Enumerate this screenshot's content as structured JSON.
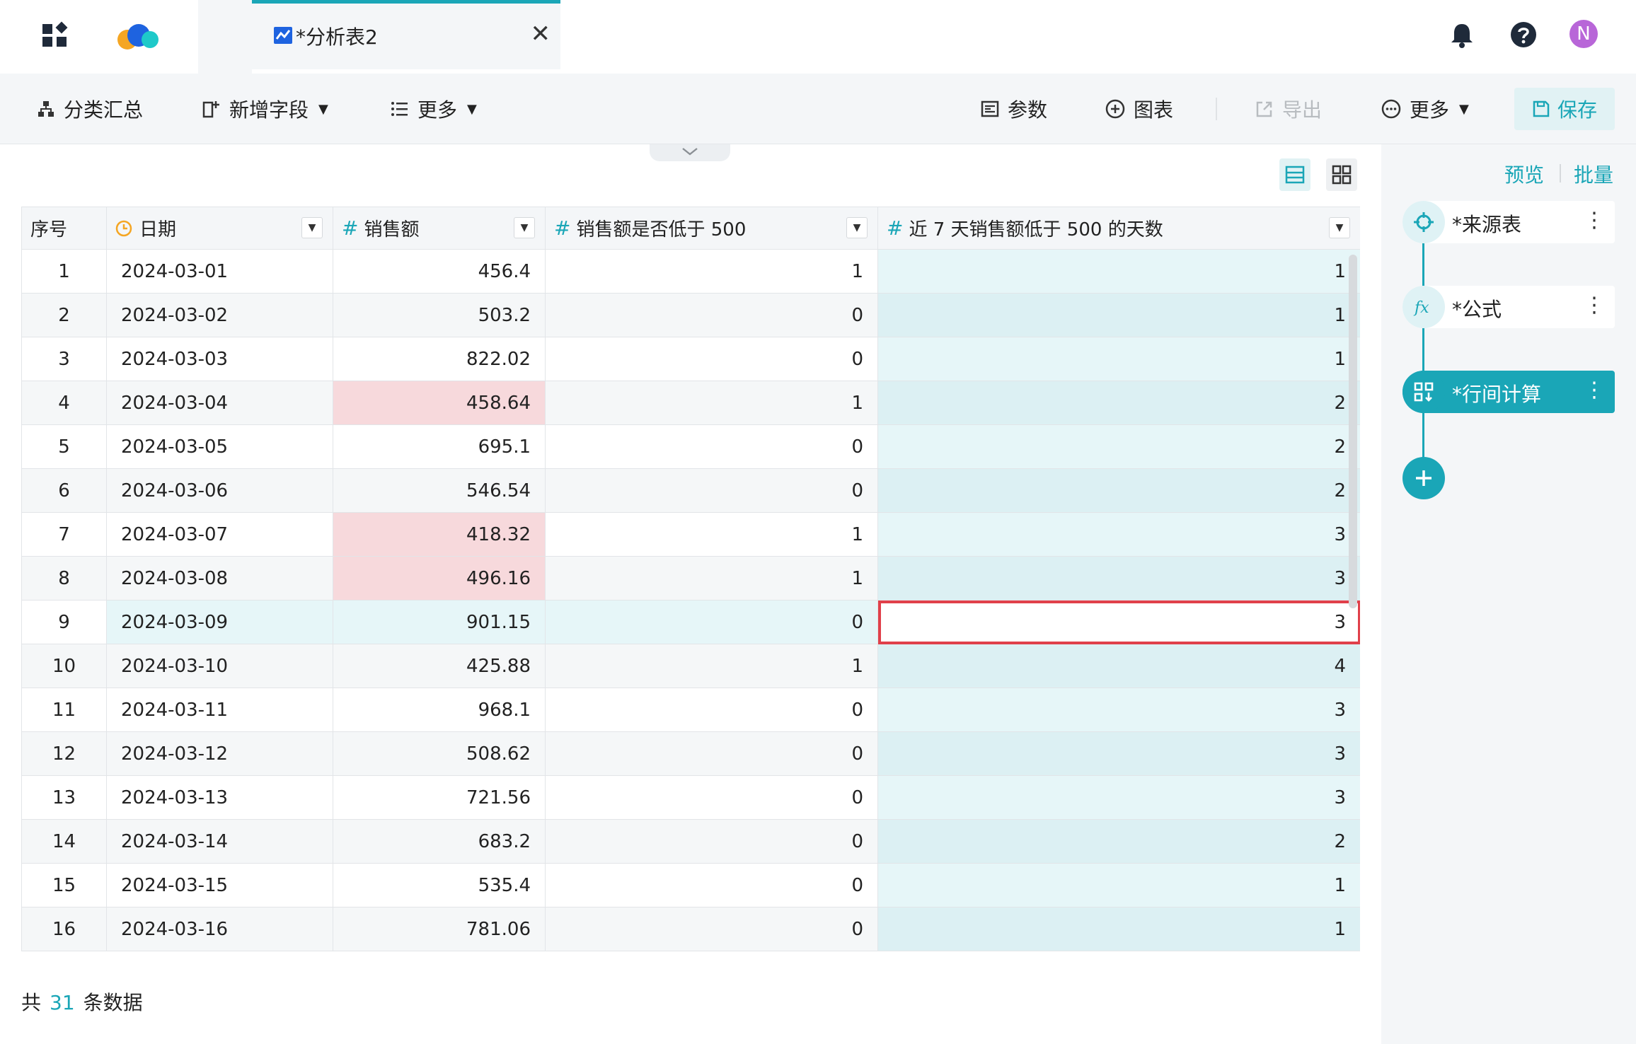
{
  "tab": {
    "title": "*分析表2",
    "close": "✕"
  },
  "user": {
    "avatar_letter": "N"
  },
  "toolbar": {
    "group_summary": "分类汇总",
    "add_field": "新增字段",
    "more_left": "更多",
    "params": "参数",
    "chart": "图表",
    "export": "导出",
    "more_right": "更多",
    "save": "保存"
  },
  "table": {
    "columns": [
      {
        "label": "序号",
        "type": "index"
      },
      {
        "label": "日期",
        "type": "date"
      },
      {
        "label": "销售额",
        "type": "number"
      },
      {
        "label": "销售额是否低于 500",
        "type": "number"
      },
      {
        "label": "近 7 天销售额低于 500 的天数",
        "type": "number"
      }
    ],
    "rows": [
      [
        "1",
        "2024-03-01",
        "456.4",
        "1",
        "1"
      ],
      [
        "2",
        "2024-03-02",
        "503.2",
        "0",
        "1"
      ],
      [
        "3",
        "2024-03-03",
        "822.02",
        "0",
        "1"
      ],
      [
        "4",
        "2024-03-04",
        "458.64",
        "1",
        "2"
      ],
      [
        "5",
        "2024-03-05",
        "695.1",
        "0",
        "2"
      ],
      [
        "6",
        "2024-03-06",
        "546.54",
        "0",
        "2"
      ],
      [
        "7",
        "2024-03-07",
        "418.32",
        "1",
        "3"
      ],
      [
        "8",
        "2024-03-08",
        "496.16",
        "1",
        "3"
      ],
      [
        "9",
        "2024-03-09",
        "901.15",
        "0",
        "3"
      ],
      [
        "10",
        "2024-03-10",
        "425.88",
        "1",
        "4"
      ],
      [
        "11",
        "2024-03-11",
        "968.1",
        "0",
        "3"
      ],
      [
        "12",
        "2024-03-12",
        "508.62",
        "0",
        "3"
      ],
      [
        "13",
        "2024-03-13",
        "721.56",
        "0",
        "3"
      ],
      [
        "14",
        "2024-03-14",
        "683.2",
        "0",
        "2"
      ],
      [
        "15",
        "2024-03-15",
        "535.4",
        "0",
        "1"
      ],
      [
        "16",
        "2024-03-16",
        "781.06",
        "0",
        "1"
      ]
    ]
  },
  "footer": {
    "prefix": "共",
    "count": "31",
    "suffix": "条数据"
  },
  "right_panel": {
    "preview": "预览",
    "batch": "批量",
    "steps": [
      {
        "label": "*来源表",
        "icon": "crosshair-icon"
      },
      {
        "label": "*公式",
        "icon": "fx-icon"
      },
      {
        "label": "*行间计算",
        "icon": "row-calc-icon"
      }
    ]
  },
  "colors": {
    "accent": "#1aa6b7",
    "highlight_pink": "#f7d9dc",
    "selection_red": "#e0404a"
  }
}
